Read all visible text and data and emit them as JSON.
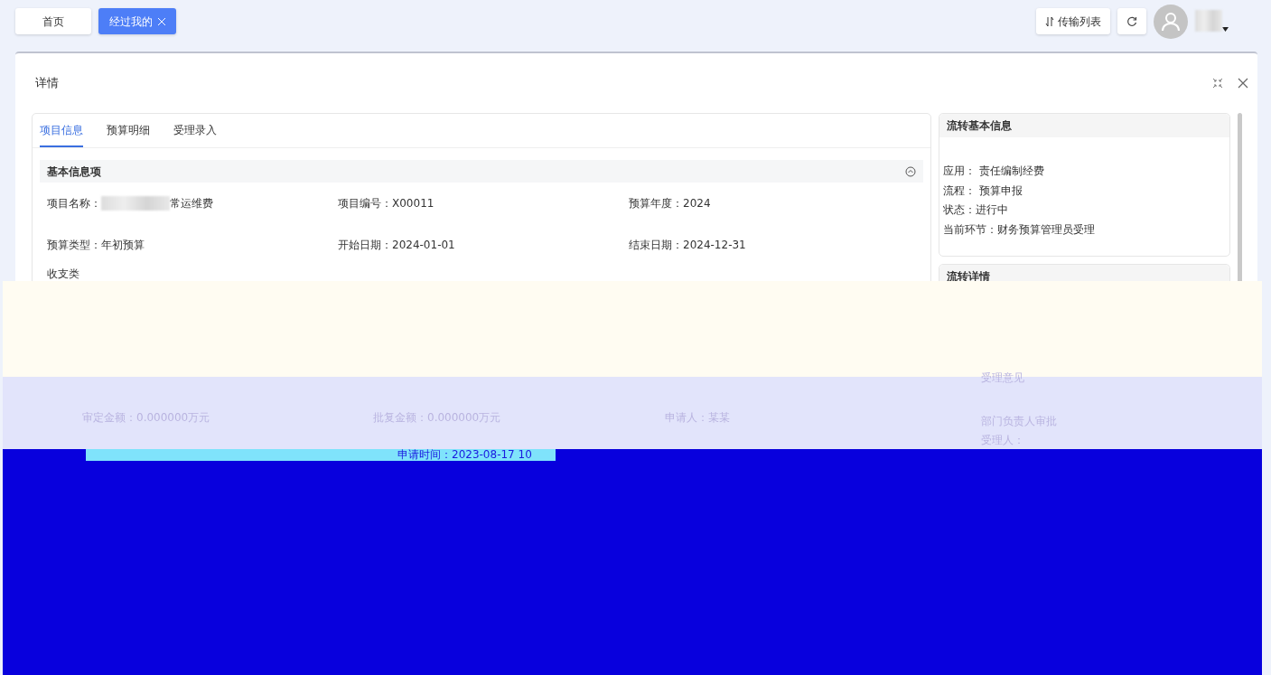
{
  "top_tabs": [
    {
      "label": "首页",
      "selected": false,
      "closable": false
    },
    {
      "label": "经过我的",
      "selected": true,
      "closable": true
    }
  ],
  "toolbar": {
    "transfer_button": "传输列表"
  },
  "dialog": {
    "title": "详情"
  },
  "detail_tabs": [
    {
      "label": "项目信息",
      "selected": true
    },
    {
      "label": "预算明细",
      "selected": false
    },
    {
      "label": "受理录入",
      "selected": false
    }
  ],
  "section": {
    "title": "基本信息项",
    "expanded": true
  },
  "fields": [
    {
      "label": "项目名称：",
      "value": "常运维费",
      "redacted": true
    },
    {
      "label": "项目编号：",
      "value": "X00011",
      "redacted": false
    },
    {
      "label": "预算年度：",
      "value": "2024",
      "redacted": false
    },
    {
      "label": "预算类型：",
      "value": "年初预算",
      "redacted": false
    },
    {
      "label": "开始日期：",
      "value": "2024-01-01",
      "redacted": false
    },
    {
      "label": "结束日期：",
      "value": "2024-12-31",
      "redacted": false
    }
  ],
  "flow_info": {
    "title": "流转基本信息",
    "lines": [
      "应用： 责任编制经费",
      "流程： 预算申报",
      "状态：进行中",
      "当前环节：财务预算管理员受理"
    ]
  },
  "flow_detail": {
    "title": "流转详情"
  },
  "glitch": {
    "partial_label": "收支类",
    "lavender_texts": [
      "审定金额：0.000000万元",
      "批复金额：0.000000万元",
      "申请人：某某",
      "受理意见",
      "部门负责人审批",
      "受理人："
    ],
    "blue_texts": [
      "申请时间：2023-08-17 10"
    ]
  }
}
